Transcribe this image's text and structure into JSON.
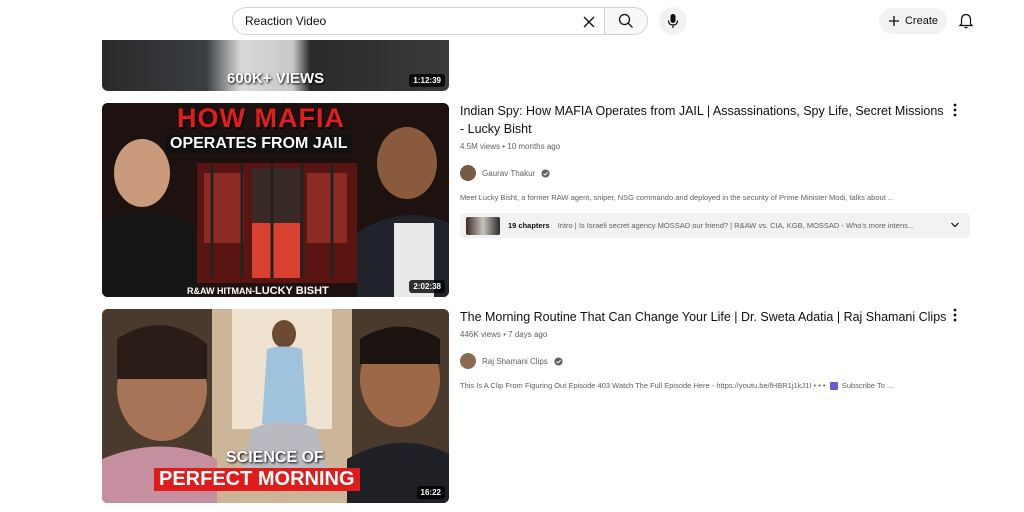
{
  "header": {
    "search_value": "Reaction Video",
    "create_label": "Create",
    "icons": [
      "search-icon",
      "clear-icon",
      "mic-icon",
      "plus-icon",
      "bell-icon"
    ]
  },
  "videos": [
    {
      "thumb_overlay": "600K+ VIEWS",
      "duration": "1:12:39"
    },
    {
      "title": "Indian Spy: How MAFIA Operates from JAIL | Assassinations, Spy Life, Secret Missions - Lucky Bisht",
      "meta": "4.5M views • 10 months ago",
      "channel": "Gaurav Thakur",
      "description": "Meet Lucky Bisht, a former RAW agent, sniper, NSG commando and deployed in the security of Prime Minister Modi, talks about ...",
      "chapters_count": "19 chapters",
      "chapters_text": "Intro | Is Israeli secret agency MOSSAD our friend? | R&AW vs. CIA, KGB, MOSSAD - Who's more intens...",
      "thumb_line1": "HOW MAFIA",
      "thumb_line2": "OPERATES FROM JAIL",
      "thumb_footer_a": "R&AW HITMAN-",
      "thumb_footer_b": "LUCKY BISHT",
      "duration": "2:02:38"
    },
    {
      "title": "The Morning Routine That Can Change Your Life | Dr. Sweta Adatia | Raj Shamani Clips",
      "meta": "446K views • 7 days ago",
      "channel": "Raj Shamani Clips",
      "description_a": "This Is A Clip From Figuring Out Episode 403 Watch The Full Episode Here - https://youtu.be/fHBR1j1kJ1I • • •",
      "description_b": "Subscribe To ...",
      "thumb_line1": "SCIENCE OF",
      "thumb_line2": "PERFECT MORNING",
      "duration": "16:22"
    }
  ],
  "colors": {
    "accent_red": "#e01b1b",
    "text_primary": "#0f0f0f",
    "text_secondary": "#606060"
  }
}
